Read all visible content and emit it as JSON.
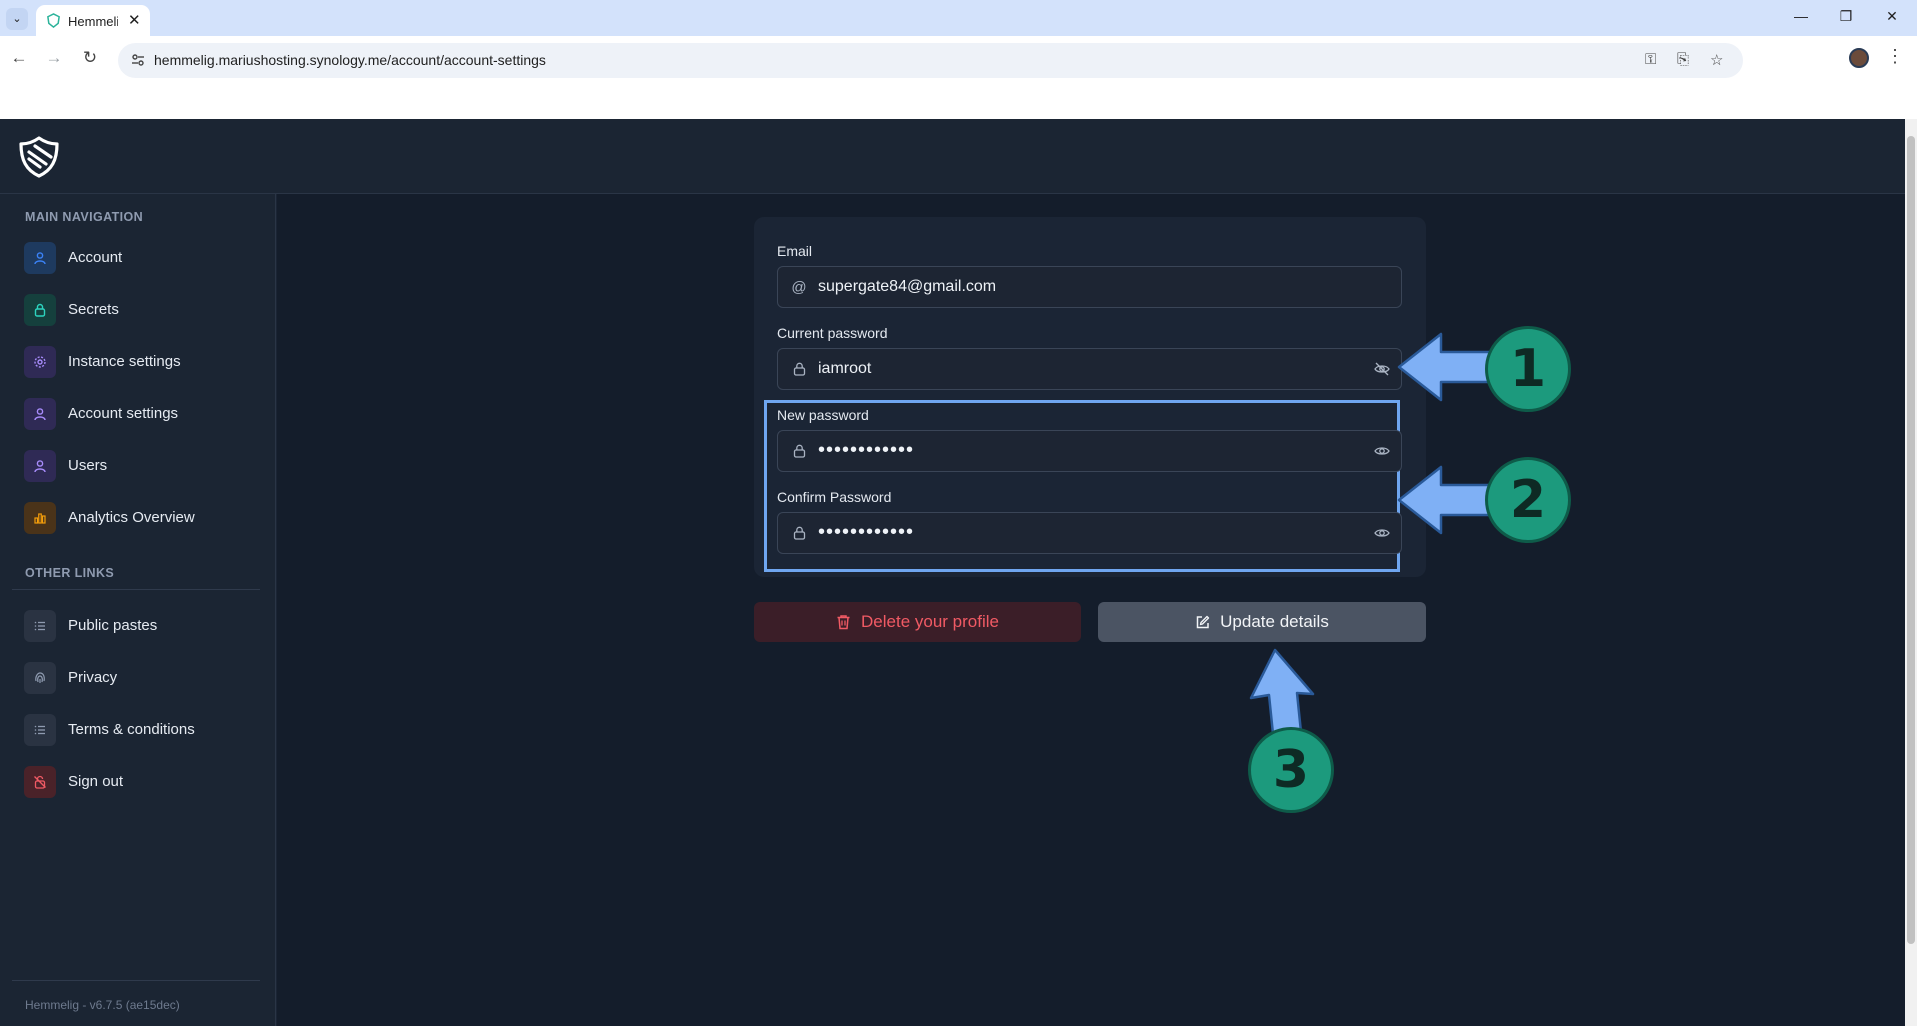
{
  "browser": {
    "tab_title": "Hemmelig",
    "url": "hemmelig.mariushosting.synology.me/account/account-settings",
    "icons": [
      "back-icon",
      "forward-icon",
      "reload-icon",
      "site-info-icon",
      "password-key-icon",
      "install-app-icon",
      "bookmark-star-icon",
      "profile-avatar",
      "kebab-menu-icon",
      "minimize-icon",
      "restore-icon",
      "close-icon"
    ]
  },
  "sidebar": {
    "main_heading": "MAIN NAVIGATION",
    "main_items": [
      {
        "label": "Account",
        "icon": "user-icon",
        "color": "#3b82f6"
      },
      {
        "label": "Secrets",
        "icon": "lock-icon",
        "color": "#2dd4bf"
      },
      {
        "label": "Instance settings",
        "icon": "gear-icon",
        "color": "#a78bfa"
      },
      {
        "label": "Account settings",
        "icon": "user-icon",
        "color": "#a78bfa"
      },
      {
        "label": "Users",
        "icon": "user-icon",
        "color": "#a78bfa"
      },
      {
        "label": "Analytics Overview",
        "icon": "bar-chart-icon",
        "color": "#f59e0b"
      }
    ],
    "other_heading": "OTHER LINKS",
    "other_items": [
      {
        "label": "Public pastes",
        "icon": "list-icon"
      },
      {
        "label": "Privacy",
        "icon": "fingerprint-icon"
      },
      {
        "label": "Terms & conditions",
        "icon": "list-icon"
      },
      {
        "label": "Sign out",
        "icon": "lock-off-icon"
      }
    ],
    "version": "Hemmelig - v6.7.5 (ae15dec)"
  },
  "form": {
    "email_label": "Email",
    "email_value": "supergate84@gmail.com",
    "current_password_label": "Current password",
    "current_password_value": "iamroot",
    "new_password_label": "New password",
    "new_password_value": "••••••••••••",
    "confirm_password_label": "Confirm Password",
    "confirm_password_value": "••••••••••••"
  },
  "buttons": {
    "delete_label": "Delete your profile",
    "update_label": "Update details"
  },
  "annotations": [
    "1",
    "2",
    "3"
  ],
  "colors": {
    "accent_arrow": "#7fb0f5",
    "annotation_circle": "#1c9a7d",
    "delete_text": "#f05a64"
  }
}
